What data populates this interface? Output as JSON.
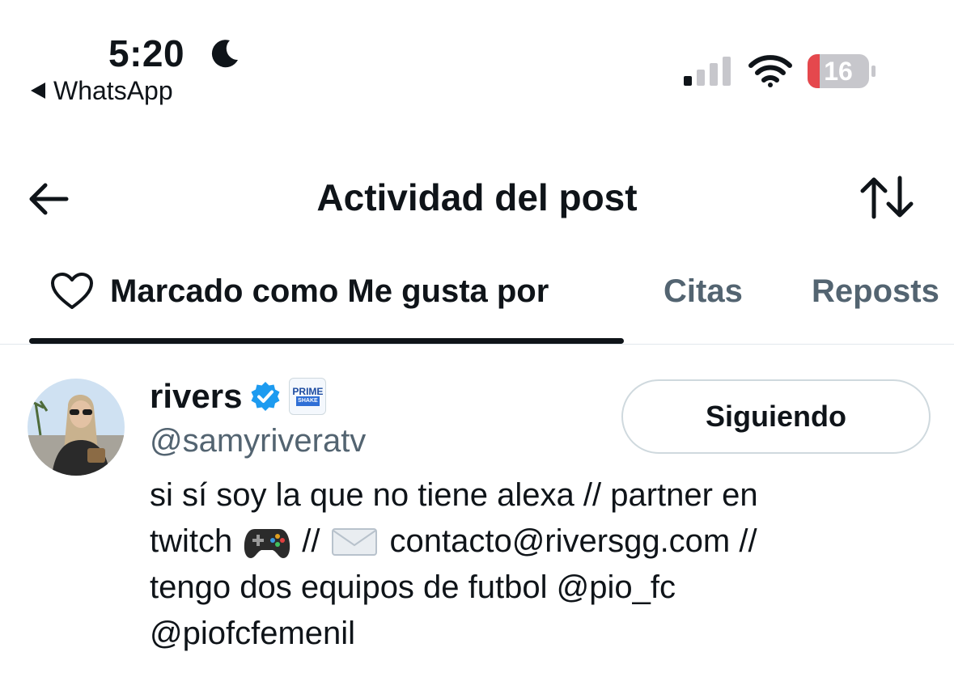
{
  "status_bar": {
    "time": "5:20",
    "back_app": "WhatsApp",
    "battery": "16",
    "icons": [
      "moon-icon",
      "cellular-signal-icon",
      "wifi-icon",
      "battery-icon"
    ]
  },
  "nav": {
    "title": "Actividad del post",
    "icons": [
      "back-arrow-icon",
      "sort-arrows-icon"
    ]
  },
  "tabs": [
    {
      "label": "Marcado como Me gusta por",
      "icon": "heart-icon",
      "active": true
    },
    {
      "label": "Citas",
      "active": false
    },
    {
      "label": "Reposts",
      "active": false
    }
  ],
  "user": {
    "name": "rivers",
    "handle": "@samyriveratv",
    "verified": true,
    "affiliate_badge": {
      "line1": "PRIME",
      "line2": "SHAKE"
    },
    "follow_button": "Siguiendo",
    "bio": {
      "line1": "si sí soy la que no tiene alexa // partner en",
      "line2_a": "twitch",
      "line2_b": "//",
      "line2_c": "contacto@riversgg.com //",
      "line3": "tengo dos equipos de futbol @pio_fc",
      "line4": "@piofcfemenil"
    }
  },
  "colors": {
    "text": "#0f1419",
    "secondary": "#536471",
    "verified_blue": "#1d9bf0",
    "battery_low": "#e5484d",
    "divider": "#e1e8ed"
  }
}
